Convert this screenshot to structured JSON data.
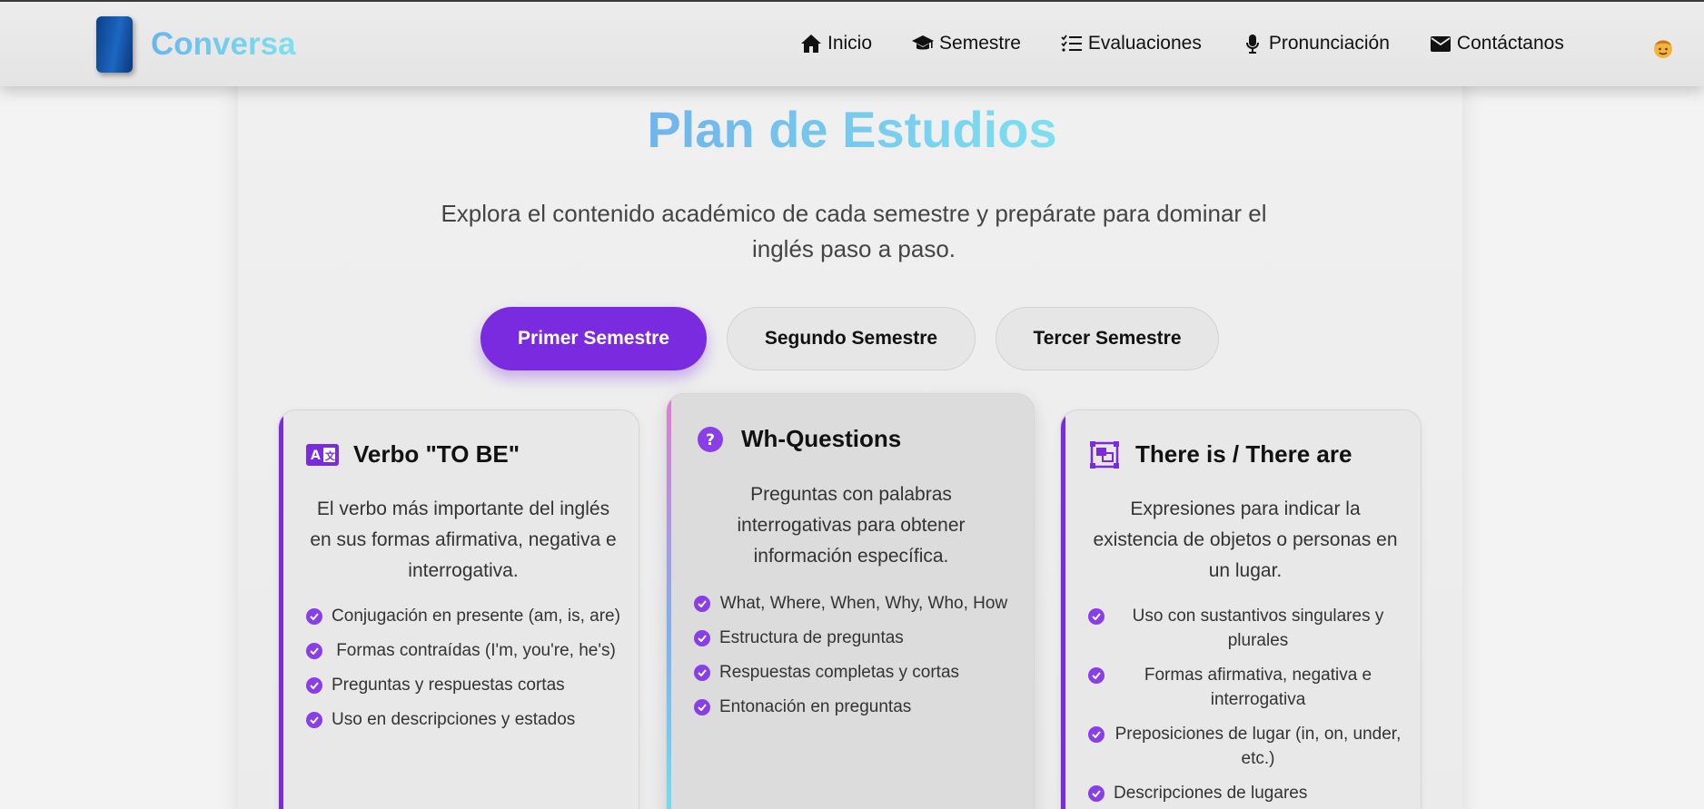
{
  "brand": {
    "name": "Conversa"
  },
  "nav": {
    "items": [
      {
        "label": "Inicio",
        "icon": "home-icon"
      },
      {
        "label": "Semestre",
        "icon": "graduation-cap-icon"
      },
      {
        "label": "Evaluaciones",
        "icon": "checklist-icon"
      },
      {
        "label": "Pronunciación",
        "icon": "microphone-icon"
      },
      {
        "label": "Contáctanos",
        "icon": "envelope-icon"
      }
    ],
    "avatar": "user-avatar-emoji"
  },
  "page": {
    "title": "Plan de Estudios",
    "subtitle": "Explora el contenido académico de cada semestre y prepárate para dominar el inglés paso a paso."
  },
  "tabs": [
    {
      "label": "Primer Semestre",
      "active": true
    },
    {
      "label": "Segundo Semestre",
      "active": false
    },
    {
      "label": "Tercer Semestre",
      "active": false
    }
  ],
  "cards": [
    {
      "icon": "translate-icon",
      "title": "Verbo \"TO BE\"",
      "description": "El verbo más importante del inglés en sus formas afirmativa, negativa e interrogativa.",
      "items": [
        "Conjugación en presente (am, is, are)",
        "Formas contraídas (I'm, you're, he's)",
        "Preguntas y respuestas cortas",
        "Uso en descripciones y estados"
      ]
    },
    {
      "icon": "question-circle-icon",
      "title": "Wh-Questions",
      "description": "Preguntas con palabras interrogativas para obtener información específica.",
      "items": [
        "What, Where, When, Why, Who, How",
        "Estructura de preguntas",
        "Respuestas completas y cortas",
        "Entonación en preguntas"
      ]
    },
    {
      "icon": "object-group-icon",
      "title": "There is / There are",
      "description": "Expresiones para indicar la existencia de objetos o personas en un lugar.",
      "items": [
        "Uso con sustantivos singulares y plurales",
        "Formas afirmativa, negativa e interrogativa",
        "Preposiciones de lugar (in, on, under, etc.)",
        "Descripciones de lugares"
      ]
    }
  ],
  "colors": {
    "accent": "#7a2be0",
    "title_gradient_start": "#70b4ec",
    "title_gradient_end": "#7de0ef",
    "check": "#8a3ee8"
  }
}
